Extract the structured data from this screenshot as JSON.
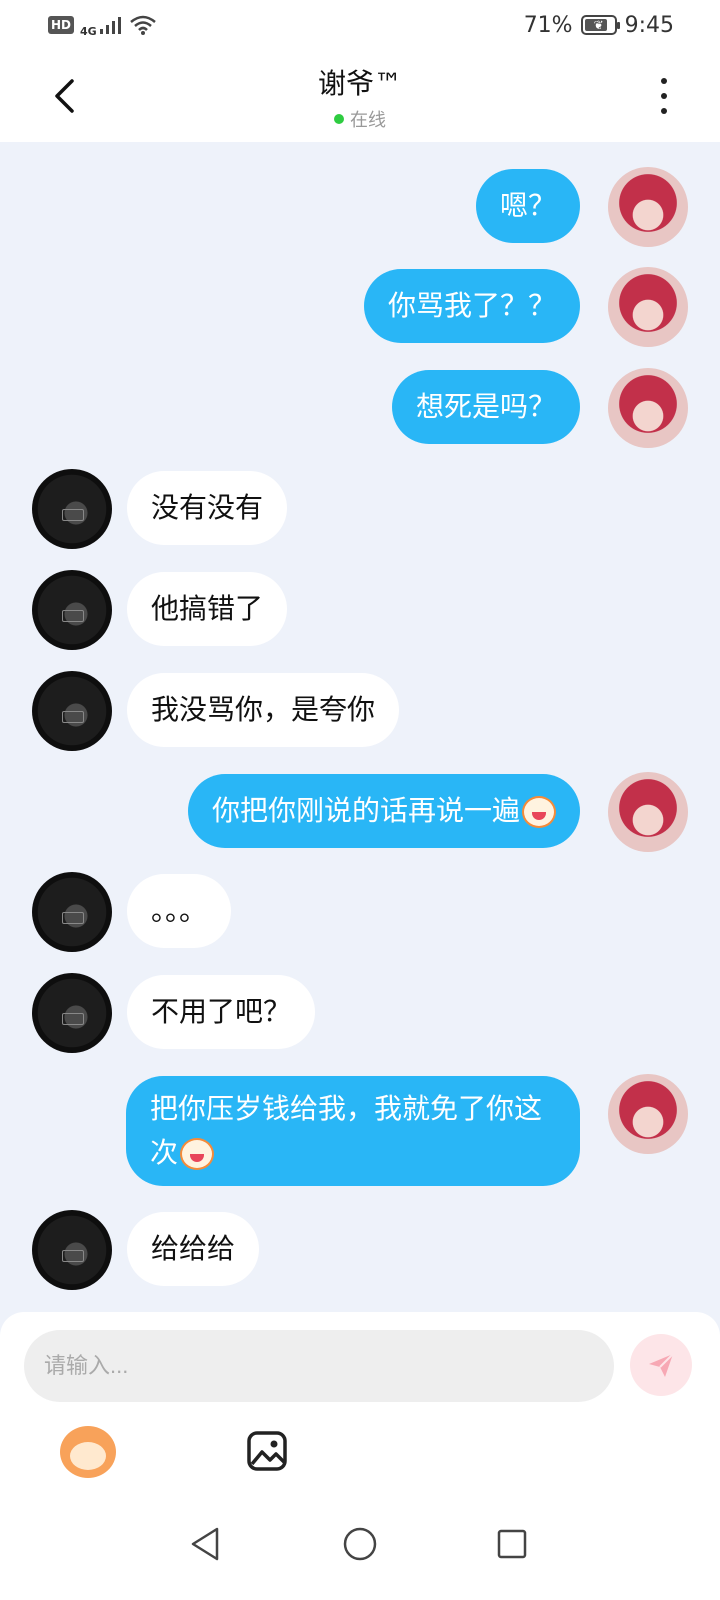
{
  "status_bar": {
    "hd": "HD",
    "network": "4G",
    "battery_percent": "71%",
    "battery_level": 0.71,
    "time": "9:45"
  },
  "header": {
    "title": "谢爷™",
    "status": "在线",
    "status_color": "#2ecc40"
  },
  "colors": {
    "my_bubble": "#29b6f6",
    "other_bubble": "#ffffff",
    "background": "#eef2fa"
  },
  "messages": [
    {
      "sender": "me",
      "text": "嗯？"
    },
    {
      "sender": "me",
      "text": "你骂我了？？"
    },
    {
      "sender": "me",
      "text": "想死是吗？"
    },
    {
      "sender": "other",
      "text": "没有没有"
    },
    {
      "sender": "other",
      "text": "他搞错了"
    },
    {
      "sender": "other",
      "text": "我没骂你，是夸你"
    },
    {
      "sender": "me",
      "text": "你把你刚说的话再说一遍",
      "emoji": "monkey-face-emoji"
    },
    {
      "sender": "other",
      "text": "。。。"
    },
    {
      "sender": "other",
      "text": "不用了吧？"
    },
    {
      "sender": "me",
      "text": "把你压岁钱给我，我就免了你这次",
      "emoji": "monkey-face-emoji"
    },
    {
      "sender": "other",
      "text": "给给给"
    }
  ],
  "composer": {
    "placeholder": "请输入...",
    "send_icon": "send-icon",
    "emoji_icon": "monkey-emoji-icon",
    "image_icon": "image-icon"
  },
  "nav": {
    "back_icon": "triangle-back-icon",
    "home_icon": "circle-home-icon",
    "recent_icon": "square-recent-icon"
  }
}
